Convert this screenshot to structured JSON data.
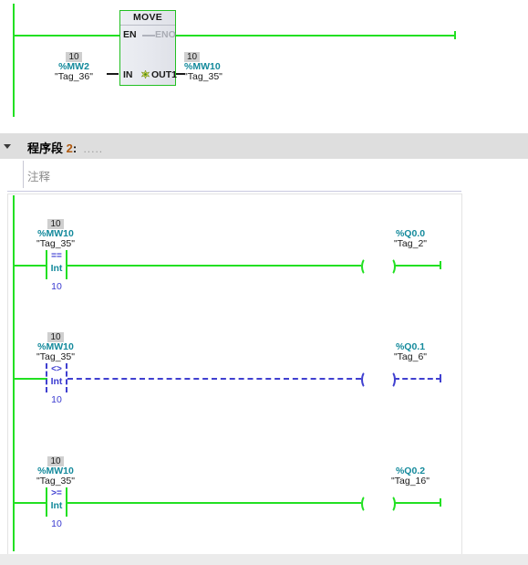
{
  "network1": {
    "block": {
      "title": "MOVE",
      "pin_en": "EN",
      "pin_eno": "ENO",
      "pin_in": "IN",
      "pin_out": "OUT1",
      "add_param_icon": "add-parameter-icon"
    },
    "input_operand": {
      "value": "10",
      "address": "%MW2",
      "symbol": "\"Tag_36\""
    },
    "output_operand": {
      "value": "10",
      "address": "%MW10",
      "symbol": "\"Tag_35\""
    }
  },
  "network2_header": {
    "collapse_icon": "collapse-triangle-icon",
    "label": "程序段",
    "number": "2",
    "colon": ":",
    "dots": ".....",
    "comment_placeholder": "注释"
  },
  "network2": {
    "rungs": [
      {
        "operand": {
          "value": "10",
          "address": "%MW10",
          "symbol": "\"Tag_35\""
        },
        "compare": {
          "operator": "==",
          "datatype": "Int",
          "compare_value": "10"
        },
        "coil": {
          "address": "%Q0.0",
          "symbol": "\"Tag_2\""
        },
        "state": "true"
      },
      {
        "operand": {
          "value": "10",
          "address": "%MW10",
          "symbol": "\"Tag_35\""
        },
        "compare": {
          "operator": "<>",
          "datatype": "Int",
          "compare_value": "10"
        },
        "coil": {
          "address": "%Q0.1",
          "symbol": "\"Tag_6\""
        },
        "state": "false"
      },
      {
        "operand": {
          "value": "10",
          "address": "%MW10",
          "symbol": "\"Tag_35\""
        },
        "compare": {
          "operator": ">=",
          "datatype": "Int",
          "compare_value": "10"
        },
        "coil": {
          "address": "%Q0.2",
          "symbol": "\"Tag_16\""
        },
        "state": "true"
      }
    ]
  },
  "colors": {
    "power_true": "#22e022",
    "power_false": "#4040d0",
    "address_text": "#148a9c",
    "value_badge_bg": "#cfcfcf",
    "header_bg": "#dedede",
    "network_number": "#b05a10"
  }
}
